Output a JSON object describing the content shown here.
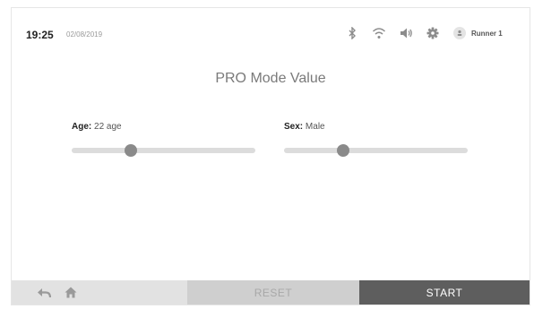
{
  "status": {
    "time": "19:25",
    "date": "02/08/2019",
    "icons": [
      "bluetooth-icon",
      "wifi-icon",
      "volume-icon",
      "gear-icon",
      "user-icon"
    ],
    "user_name": "Runner 1"
  },
  "title": "PRO Mode Value",
  "params": {
    "age": {
      "key": "Age",
      "sep": ":",
      "value": "22 age",
      "level": 0.32
    },
    "sex": {
      "key": "Sex",
      "sep": ":",
      "value": "Male",
      "level": 0.32
    }
  },
  "footer": {
    "reset_label": "RESET",
    "start_label": "START"
  },
  "colors": {
    "start_bg": "#5e5e5e",
    "reset_bg": "#cfcfcf",
    "nav_bg": "#e2e2e2",
    "slider_thumb": "#8a8a8a",
    "slider_track": "#dcdcdc"
  }
}
